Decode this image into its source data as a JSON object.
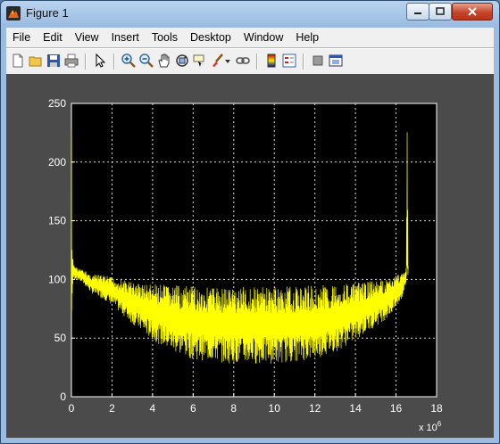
{
  "window": {
    "title": "Figure 1"
  },
  "menu": {
    "file": "File",
    "edit": "Edit",
    "view": "View",
    "insert": "Insert",
    "tools": "Tools",
    "desktop": "Desktop",
    "window": "Window",
    "help": "Help"
  },
  "toolbar": {
    "icons": [
      "new-figure-icon",
      "open-file-icon",
      "save-icon",
      "print-icon",
      "edit-plot-arrow-icon",
      "zoom-in-icon",
      "zoom-out-icon",
      "pan-icon",
      "rotate-3d-icon",
      "data-cursor-icon",
      "brush-icon",
      "link-plot-icon",
      "insert-colorbar-icon",
      "insert-legend-icon",
      "hide-plot-tools-icon",
      "show-plot-tools-icon"
    ]
  },
  "chart_data": {
    "type": "line",
    "title": "",
    "xlabel": "",
    "ylabel": "",
    "x_exponent_label": "x 10",
    "x_exponent_power": "6",
    "xlim": [
      0,
      18
    ],
    "ylim": [
      0,
      250
    ],
    "xticks": [
      0,
      2,
      4,
      6,
      8,
      10,
      12,
      14,
      16,
      18
    ],
    "yticks": [
      0,
      50,
      100,
      150,
      200,
      250
    ],
    "grid": true,
    "background": "#000000",
    "line_color": "#ffff00",
    "series": [
      {
        "x": [
          0,
          0.02,
          0.1,
          0.3,
          0.6,
          1,
          1.5,
          2,
          2.5,
          3,
          4,
          5,
          6,
          7,
          8,
          9,
          10,
          11,
          12,
          13,
          14,
          15,
          15.5,
          16,
          16.3,
          16.5,
          16.55,
          16.6
        ],
        "upper": [
          228,
          128,
          114,
          110,
          108,
          104,
          104,
          102,
          100,
          98,
          96,
          95,
          94,
          94,
          94,
          94,
          94,
          94,
          95,
          96,
          97,
          99,
          100,
          104,
          107,
          110,
          228,
          112
        ],
        "lower": [
          0,
          80,
          100,
          100,
          96,
          88,
          84,
          78,
          70,
          62,
          48,
          38,
          32,
          30,
          28,
          28,
          28,
          30,
          32,
          38,
          48,
          60,
          66,
          74,
          84,
          96,
          100,
          100
        ]
      }
    ]
  }
}
